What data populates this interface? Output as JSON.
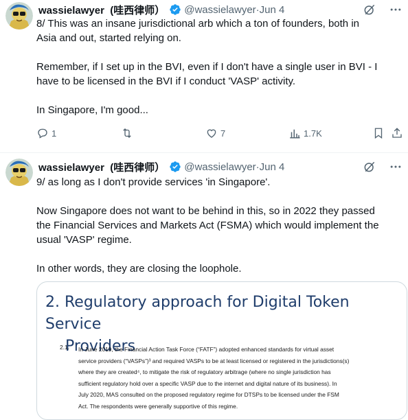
{
  "colors": {
    "verified": "#1d9bf0",
    "text": "#0f1419",
    "muted": "#536471",
    "border": "#cfd9de",
    "doc_heading": "#1f3d6b"
  },
  "icons": [
    "verified-badge-icon",
    "grok-icon",
    "more-icon",
    "reply-icon",
    "retweet-icon",
    "like-icon",
    "views-icon",
    "bookmark-icon",
    "share-icon"
  ],
  "tweets": [
    {
      "name": "wassielawyer  (哇西律师）",
      "handle": "@wassielawyer",
      "sep": " · ",
      "date": "Jun 4",
      "lines": [
        "8/ This was an insane jurisdictional arb which a ton of founders, both in",
        "Asia and out, started relying on.",
        "",
        "Remember, if I set up in the BVI, even if I don't have a single user in BVI - I",
        "have to be licensed in the BVI if I conduct 'VASP' activity.",
        "",
        "In Singapore, I'm good..."
      ],
      "stats": {
        "replies": "1",
        "retweets": "",
        "likes": "7",
        "views": "1.7K"
      }
    },
    {
      "name": "wassielawyer  (哇西律师）",
      "handle": "@wassielawyer",
      "sep": " · ",
      "date": "Jun 4",
      "lines": [
        "9/ as long as I don't provide services 'in Singapore'.",
        "",
        "Now Singapore does not want to be behind in this, so in 2022 they passed",
        "the Financial Services and Markets Act (FSMA) which would implement the",
        "usual 'VASP' regime.",
        "",
        "In other words, they are closing the loophole."
      ],
      "document": {
        "heading_line1": "2. Regulatory approach for Digital Token Service",
        "heading_line2": "Providers",
        "para_number": "2.1.",
        "para_lines": [
          "In June 2019, the Financial Action Task Force (“FATF”) adopted enhanced standards for virtual asset",
          "service providers (“VASPs”)³ and required VASPs to be at least licensed or registered in the jurisdictions(s)",
          "where they are created⁴, to mitigate the risk of regulatory arbitrage (where no single jurisdiction has",
          "sufficient regulatory hold over a specific VASP due to the internet and digital nature of its business). In",
          "July 2020, MAS consulted on the proposed regulatory regime for DTSPs to be licensed under the FSM",
          "Act. The respondents were generally supportive of this regime."
        ]
      }
    }
  ]
}
